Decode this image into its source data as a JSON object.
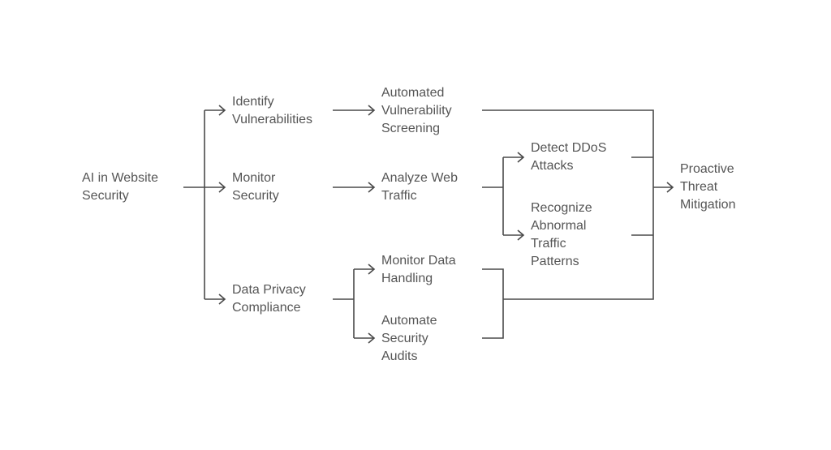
{
  "diagram": {
    "colors": {
      "line": "#4a4a4a",
      "text": "#555555"
    },
    "nodes": {
      "root": [
        "AI in Website",
        "Security"
      ],
      "identify": [
        "Identify",
        "Vulnerabilities"
      ],
      "monitor": [
        "Monitor",
        "Security"
      ],
      "privacy": [
        "Data Privacy",
        "Compliance"
      ],
      "screening": [
        "Automated",
        "Vulnerability",
        "Screening"
      ],
      "traffic": [
        "Analyze Web",
        "Traffic"
      ],
      "data_handling": [
        "Monitor Data",
        "Handling"
      ],
      "audits": [
        "Automate",
        "Security",
        "Audits"
      ],
      "ddos": [
        "Detect DDoS",
        "Attacks"
      ],
      "abnormal": [
        "Recognize",
        "Abnormal",
        "Traffic",
        "Patterns"
      ],
      "result": [
        "Proactive",
        "Threat",
        "Mitigation"
      ]
    },
    "edges": [
      [
        "root",
        "identify"
      ],
      [
        "root",
        "monitor"
      ],
      [
        "root",
        "privacy"
      ],
      [
        "identify",
        "screening"
      ],
      [
        "monitor",
        "traffic"
      ],
      [
        "privacy",
        "data_handling"
      ],
      [
        "privacy",
        "audits"
      ],
      [
        "traffic",
        "ddos"
      ],
      [
        "traffic",
        "abnormal"
      ],
      [
        "screening",
        "result"
      ],
      [
        "ddos",
        "result"
      ],
      [
        "abnormal",
        "result"
      ],
      [
        "data_handling",
        "result"
      ],
      [
        "audits",
        "result"
      ]
    ]
  }
}
